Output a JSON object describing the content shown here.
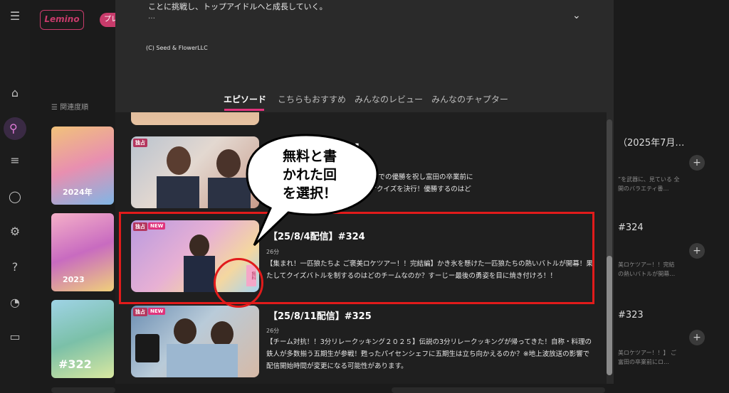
{
  "app": {
    "logo_text": "Lemino",
    "chip_label": "プレ"
  },
  "background": {
    "sort_label": "関連度順",
    "right_items": [
      {
        "title": "（2025年7月…",
        "sub": "”を武器に、見ている 全開のバラエティ番…"
      },
      {
        "title": "#324",
        "sub": "美ロケツアー！！完結 の熱いバトルが開幕…"
      },
      {
        "title": "#323",
        "sub": "美ロケツアー！！】 ご 富田の卒業前にロ…"
      }
    ],
    "thumb_labels": [
      "2024年",
      "2023",
      "#322"
    ]
  },
  "modal": {
    "description": "ことに挑戦し、トップアイドルへと成長していく。",
    "ellipsis": "…",
    "copyright": "(C) Seed & FlowerLLC",
    "tabs": [
      {
        "label": "エピソード"
      },
      {
        "label": "こちらもおすすめ"
      },
      {
        "label": "みんなのレビュー"
      },
      {
        "label": "みんなのチャプター"
      }
    ]
  },
  "episodes": [
    {
      "title_partial": "【",
      "title_partial_end": "3】",
      "desc_line1": "ケツアー！！】 ごちゃまぜ絆バトルでの優勝を祝し富田の卒業前に",
      "desc_line2": "大暴れ！？スタジオでは恒例のロケクイズを決行！優勝するのはど",
      "badge_exclusive": "独占"
    },
    {
      "title": "【25/8/4配信】#324",
      "duration": "26分",
      "description": "【集まれ！一匹狼たちよ ご褒美ロケツアー！！完結編】かき氷を懸けた一匹狼たちの熱いバトルが開幕！果たしてクイズバトルを制するのはどのチームなのか？すーじー最後の勇姿を目に焼き付けろ！！",
      "badge_exclusive": "独占",
      "badge_new": "NEW",
      "free_tag": "無料"
    },
    {
      "title": "【25/8/11配信】#325",
      "duration": "26分",
      "description": "【チーム対抗！！3分リレークッキング２０２５】伝説の3分リレークッキングが帰ってきた！自称・料理の鉄人が多数揃う五期生が参戦！甦ったパイセンシェフに五期生は立ち向かえるのか？※地上波放送の影響で配信開始時間が変更になる可能性があります。",
      "badge_exclusive": "独占",
      "badge_new": "NEW"
    }
  ],
  "annotation": {
    "callout_line1": "無料と書",
    "callout_line2": "かれた回",
    "callout_line3": "を選択！"
  },
  "colors": {
    "accent": "#e0337c",
    "highlight": "#e11b1b",
    "modal_bg": "#2a2a2a"
  }
}
